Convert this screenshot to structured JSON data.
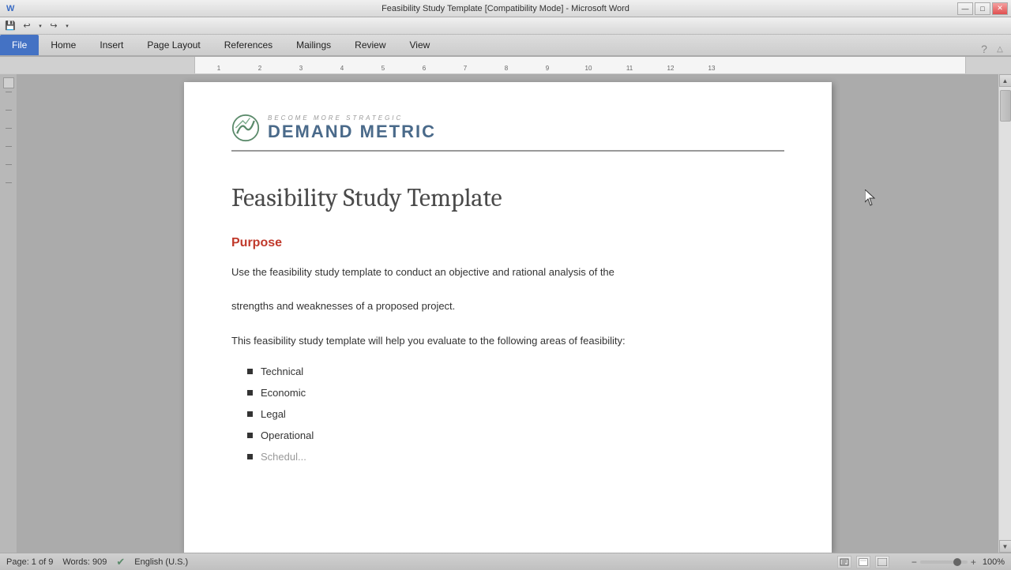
{
  "titlebar": {
    "title": "Feasibility Study Template [Compatibility Mode] - Microsoft Word",
    "minimize": "—",
    "maximize": "□",
    "close": "✕"
  },
  "quickaccess": {
    "save_icon": "💾",
    "undo_icon": "↩",
    "redo_icon": "↪",
    "dropdown_icon": "▾"
  },
  "ribbon": {
    "tabs": [
      "File",
      "Home",
      "Insert",
      "Page Layout",
      "References",
      "Mailings",
      "Review",
      "View"
    ],
    "active_tab": "File"
  },
  "document": {
    "logo_tagline": "Become More Strategic",
    "logo_name": "Demand Metric",
    "title": "Feasibility Study Template",
    "section_heading": "Purpose",
    "body_text_1": "Use the feasibility study template to conduct an objective and rational analysis of the",
    "body_text_2": "strengths and weaknesses of a proposed project.",
    "intro_text": "This feasibility study template will help you evaluate to the following areas of feasibility:",
    "bullet_items": [
      "Technical",
      "Economic",
      "Legal",
      "Operational",
      "Schedule"
    ]
  },
  "statusbar": {
    "page_info": "Page: 1 of 9",
    "words": "Words: 909",
    "language": "English (U.S.)",
    "zoom": "100%"
  },
  "colors": {
    "accent_blue": "#4472c4",
    "heading_red": "#c0504d",
    "logo_blue": "#4a6a8a"
  }
}
